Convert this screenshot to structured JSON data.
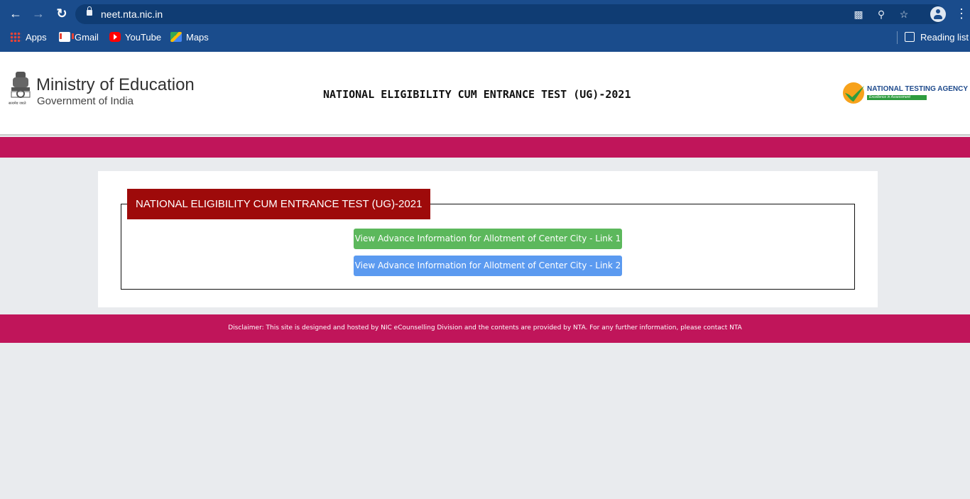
{
  "browser": {
    "url": "neet.nta.nic.in",
    "nav_icons": {
      "back": "arrow-left-icon",
      "forward": "arrow-right-icon",
      "reload": "reload-icon"
    },
    "bookmarks": [
      {
        "label": "Apps",
        "icon": "apps-grid-icon"
      },
      {
        "label": "Gmail",
        "icon": "gmail-icon"
      },
      {
        "label": "YouTube",
        "icon": "youtube-icon"
      },
      {
        "label": "Maps",
        "icon": "maps-icon"
      }
    ],
    "reading_list": "Reading list"
  },
  "header": {
    "ministry_title": "Ministry of Education",
    "ministry_subtitle": "Government of India",
    "emblem_motto": "सत्यमेव जयते",
    "page_title": "NATIONAL ELIGIBILITY CUM ENTRANCE TEST (UG)-2021",
    "nta_name": "NATIONAL TESTING AGENCY",
    "nta_tagline": "Excellence in Assessment"
  },
  "main": {
    "legend": "NATIONAL ELIGIBILITY CUM ENTRANCE TEST (UG)-2021",
    "buttons": [
      {
        "label": "View Advance Information for Allotment of Center City - Link 1",
        "color": "#5cb85c"
      },
      {
        "label": "View Advance Information for Allotment of Center City - Link 2",
        "color": "#5b9af0"
      }
    ]
  },
  "footer": {
    "disclaimer": "Disclaimer: This site is designed and hosted by NIC eCounselling Division and the contents are provided by NTA. For any further information, please contact NTA"
  },
  "colors": {
    "chrome": "#1a4c8c",
    "brand_band": "#c0155a",
    "legend_bg": "#9e0a0a"
  }
}
